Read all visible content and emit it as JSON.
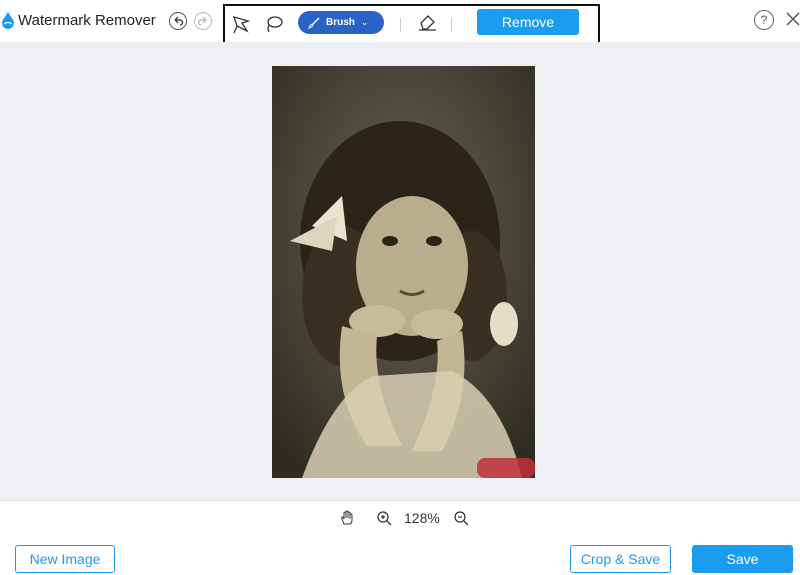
{
  "app": {
    "title": "Watermark Remover"
  },
  "toolbar": {
    "brush_label": "Brush",
    "remove_label": "Remove",
    "tools": [
      "polygonal-lasso-icon",
      "lasso-icon",
      "brush-icon",
      "eraser-icon"
    ]
  },
  "header_icons": [
    "undo-icon",
    "redo-icon",
    "help-icon",
    "close-icon"
  ],
  "zoom": {
    "level": "128%"
  },
  "footer": {
    "new_image_label": "New Image",
    "crop_save_label": "Crop & Save",
    "save_label": "Save"
  },
  "colors": {
    "accent": "#1a9cf0",
    "brush_active": "#2a63c8",
    "canvas_bg": "#eef0f3"
  }
}
